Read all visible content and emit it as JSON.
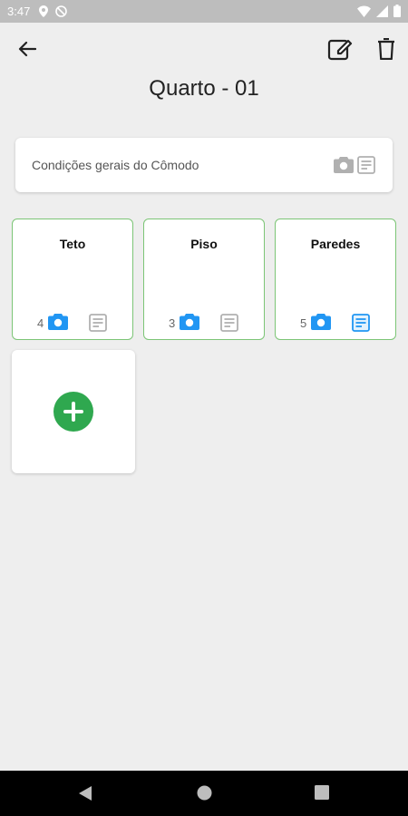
{
  "status_bar": {
    "time": "3:47",
    "icons": [
      "location-icon",
      "no-disturb-icon",
      "wifi-icon",
      "signal-icon",
      "battery-icon"
    ]
  },
  "toolbar": {
    "back_icon": "arrow-left-icon",
    "edit_icon": "edit-icon",
    "delete_icon": "trash-icon"
  },
  "page": {
    "title": "Quarto - 01"
  },
  "general_card": {
    "label": "Condições gerais do Cômodo",
    "camera_icon": "camera-icon",
    "note_icon": "note-icon"
  },
  "elements": [
    {
      "name": "Teto",
      "photo_count": "4",
      "note_active": false
    },
    {
      "name": "Piso",
      "photo_count": "3",
      "note_active": false
    },
    {
      "name": "Paredes",
      "photo_count": "5",
      "note_active": true
    }
  ],
  "add_card": {
    "icon": "plus-icon"
  },
  "nav_bar": {
    "icons": [
      "nav-back-icon",
      "nav-home-icon",
      "nav-recents-icon"
    ]
  },
  "colors": {
    "accent_blue": "#2196f3",
    "inactive_gray": "#b0b0b0",
    "card_border_green": "#7cc576",
    "add_button_green": "#2fa84f",
    "background": "#eeeeee"
  }
}
